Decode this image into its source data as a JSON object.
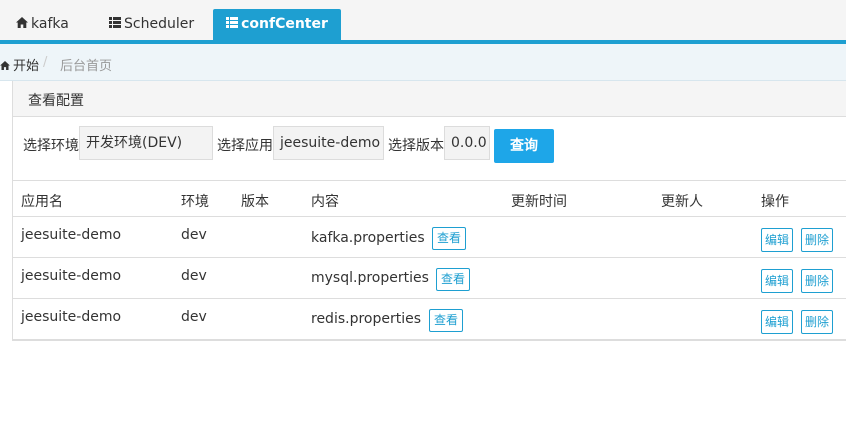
{
  "nav": {
    "tabs": [
      {
        "label": "kafka",
        "icon": "home-icon"
      },
      {
        "label": "Scheduler",
        "icon": "list-icon"
      },
      {
        "label": "confCenter",
        "icon": "list-icon",
        "active": true
      }
    ]
  },
  "breadcrumb": {
    "home": "开始",
    "separator": "/",
    "current": "后台首页"
  },
  "panel": {
    "title": "查看配置"
  },
  "filters": {
    "env_label": "选择环境",
    "env_value": "开发环境(DEV)",
    "app_label": "选择应用",
    "app_value": "jeesuite-demo",
    "version_label": "选择版本",
    "version_value": "0.0.0",
    "query_button": "查询"
  },
  "table": {
    "headers": {
      "app": "应用名",
      "env": "环境",
      "version": "版本",
      "content": "内容",
      "updated_at": "更新时间",
      "updated_by": "更新人",
      "actions": "操作"
    },
    "rows": [
      {
        "app": "jeesuite-demo",
        "env": "dev",
        "version": "",
        "content": "kafka.properties",
        "view": "查看",
        "updated_at": "",
        "updated_by": "",
        "edit": "编辑",
        "delete": "删除"
      },
      {
        "app": "jeesuite-demo",
        "env": "dev",
        "version": "",
        "content": "mysql.properties",
        "view": "查看",
        "updated_at": "",
        "updated_by": "",
        "edit": "编辑",
        "delete": "删除"
      },
      {
        "app": "jeesuite-demo",
        "env": "dev",
        "version": "",
        "content": "redis.properties",
        "view": "查看",
        "updated_at": "",
        "updated_by": "",
        "edit": "编辑",
        "delete": "删除"
      }
    ]
  },
  "colors": {
    "accent": "#1e9fd1",
    "query_button": "#1ea6e8",
    "breadcrumb_bg": "#eef5f9"
  }
}
